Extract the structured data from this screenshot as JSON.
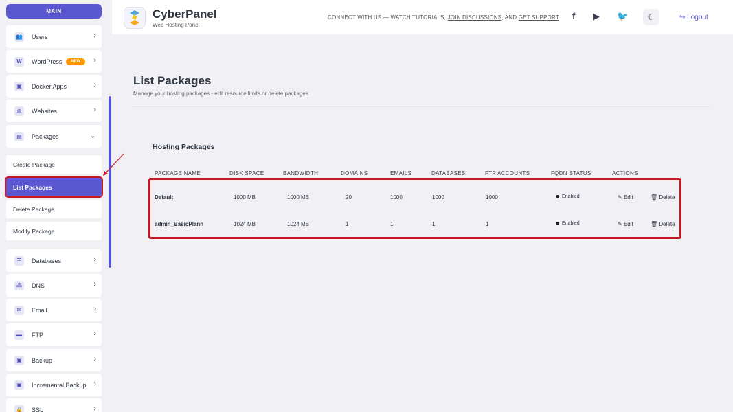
{
  "sidebar": {
    "main_label": "MAIN",
    "items": [
      {
        "label": "Users",
        "icon": "users-icon"
      },
      {
        "label": "WordPress",
        "icon": "wordpress-icon",
        "badge": "NEW"
      },
      {
        "label": "Docker Apps",
        "icon": "docker-icon"
      },
      {
        "label": "Websites",
        "icon": "globe-icon"
      },
      {
        "label": "Packages",
        "icon": "package-icon"
      },
      {
        "label": "Databases",
        "icon": "database-icon"
      },
      {
        "label": "DNS",
        "icon": "sitemap-icon"
      },
      {
        "label": "Email",
        "icon": "envelope-icon"
      },
      {
        "label": "FTP",
        "icon": "folder-icon"
      },
      {
        "label": "Backup",
        "icon": "save-icon"
      },
      {
        "label": "Incremental Backup",
        "icon": "save-icon"
      },
      {
        "label": "SSL",
        "icon": "lock-icon"
      }
    ],
    "sub_items": [
      "Create Package",
      "List Packages",
      "Delete Package",
      "Modify Package"
    ]
  },
  "header": {
    "brand": "CyberPanel",
    "brand_sub": "Web Hosting Panel",
    "connect_prefix": "CONNECT WITH US — WATCH TUTORIALS,",
    "join_link": "JOIN DISCUSSIONS",
    "connect_mid": ", AND",
    "support_link": "GET SUPPORT",
    "connect_end": ".",
    "logout": "Logout"
  },
  "page": {
    "title": "List Packages",
    "subtitle": "Manage your hosting packages - edit resource limits or delete packages",
    "section_title": "Hosting Packages"
  },
  "table": {
    "headers": [
      "PACKAGE NAME",
      "DISK SPACE",
      "BANDWIDTH",
      "DOMAINS",
      "EMAILS",
      "DATABASES",
      "FTP ACCOUNTS",
      "FQDN STATUS",
      "ACTIONS"
    ],
    "rows": [
      {
        "name": "Default",
        "disk": "1000 MB",
        "bandwidth": "1000 MB",
        "domains": "20",
        "emails": "1000",
        "databases": "1000",
        "ftp": "1000",
        "fqdn": "Enabled"
      },
      {
        "name": "admin_BasicPlann",
        "disk": "1024 MB",
        "bandwidth": "1024 MB",
        "domains": "1",
        "emails": "1",
        "databases": "1",
        "ftp": "1",
        "fqdn": "Enabled"
      }
    ],
    "edit_label": "Edit",
    "delete_label": "Delete"
  },
  "colors": {
    "accent": "#5b57d1",
    "highlight": "#c41822",
    "badge": "#ff9800"
  }
}
